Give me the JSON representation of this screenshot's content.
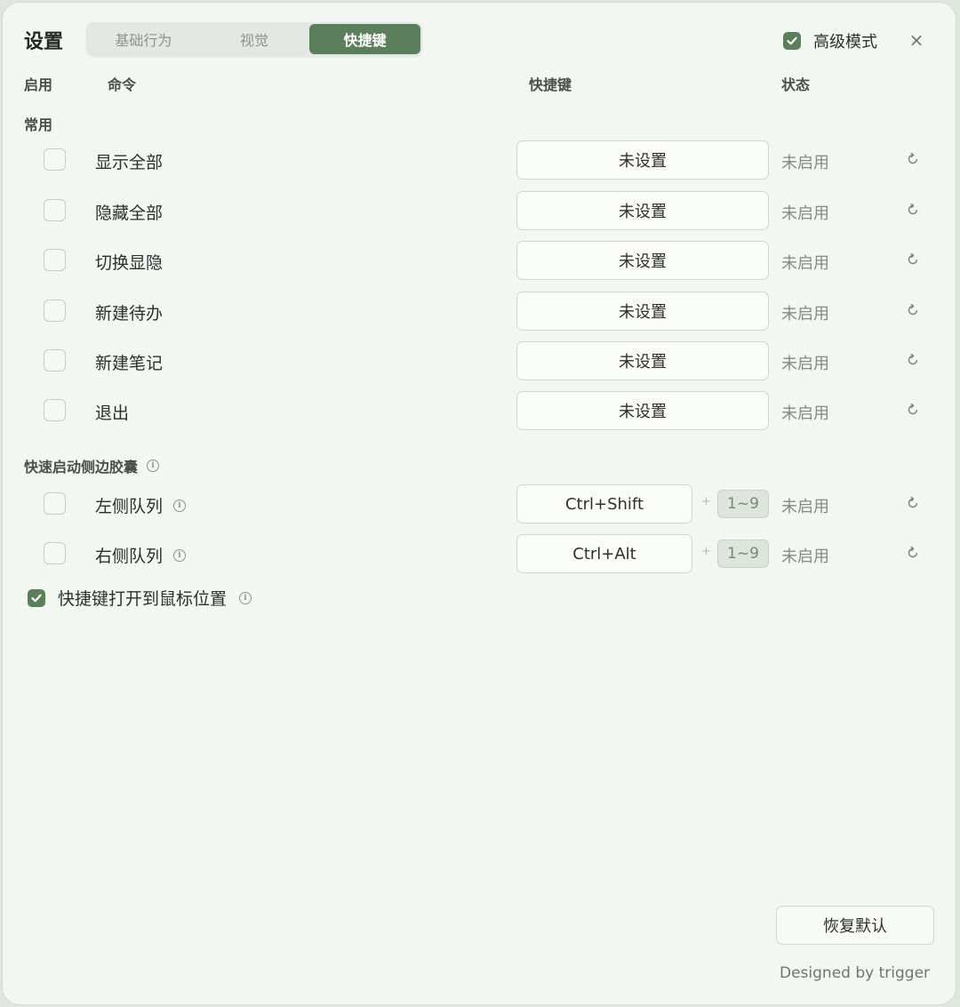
{
  "window": {
    "title": "设置"
  },
  "tabs": [
    {
      "label": "基础行为",
      "active": false
    },
    {
      "label": "视觉",
      "active": false
    },
    {
      "label": "快捷键",
      "active": true
    }
  ],
  "advanced_mode": {
    "label": "高级模式",
    "checked": true
  },
  "close": {
    "glyph": "×"
  },
  "columns": {
    "enable": "启用",
    "command": "命令",
    "shortcut": "快捷键",
    "status": "状态"
  },
  "sections": {
    "common": "常用",
    "capsule": "快速启动侧边胶囊"
  },
  "common_rows": [
    {
      "command": "显示全部",
      "shortcut": "未设置",
      "status": "未启用"
    },
    {
      "command": "隐藏全部",
      "shortcut": "未设置",
      "status": "未启用"
    },
    {
      "command": "切换显隐",
      "shortcut": "未设置",
      "status": "未启用"
    },
    {
      "command": "新建待办",
      "shortcut": "未设置",
      "status": "未启用"
    },
    {
      "command": "新建笔记",
      "shortcut": "未设置",
      "status": "未启用"
    },
    {
      "command": "退出",
      "shortcut": "未设置",
      "status": "未启用"
    }
  ],
  "capsule_rows": [
    {
      "command": "左侧队列",
      "shortcut": "Ctrl+Shift",
      "plus": "+",
      "range": "1~9",
      "status": "未启用"
    },
    {
      "command": "右侧队列",
      "shortcut": "Ctrl+Alt",
      "plus": "+",
      "range": "1~9",
      "status": "未启用"
    }
  ],
  "mouse_position": {
    "label": "快捷键打开到鼠标位置",
    "checked": true
  },
  "info_glyph": "i",
  "reset_button": {
    "label": "恢复默认"
  },
  "footer": {
    "text": "Designed by trigger"
  },
  "colors": {
    "accent": "#5b7f5b",
    "background": "#f2f7f1"
  }
}
